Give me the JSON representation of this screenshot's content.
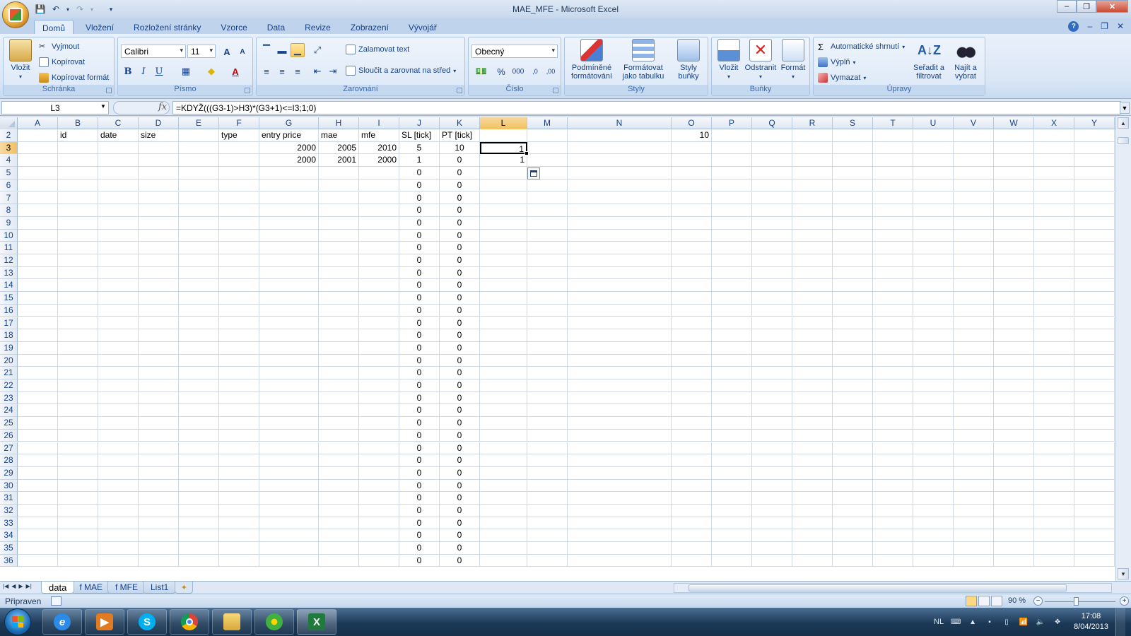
{
  "window": {
    "title": "MAE_MFE - Microsoft Excel",
    "minimize": "–",
    "restore": "❐",
    "close": "✕"
  },
  "ribbon_tabs": [
    "Domů",
    "Vložení",
    "Rozložení stránky",
    "Vzorce",
    "Data",
    "Revize",
    "Zobrazení",
    "Vývojář"
  ],
  "ribbon": {
    "clipboard": {
      "label": "Schránka",
      "paste": "Vložit",
      "cut": "Vyjmout",
      "copy": "Kopírovat",
      "format_painter": "Kopírovat formát"
    },
    "font": {
      "label": "Písmo",
      "font_name": "Calibri",
      "font_size": "11",
      "bold": "B",
      "italic": "I",
      "underline": "U",
      "grow": "A",
      "shrink": "A"
    },
    "alignment": {
      "label": "Zarovnání",
      "wrap": "Zalamovat text",
      "merge": "Sloučit a zarovnat na střed"
    },
    "number": {
      "label": "Číslo",
      "format": "Obecný",
      "percent": "%",
      "thousands": "000",
      "inc_decimal": ",0",
      "dec_decimal": ",00"
    },
    "styles": {
      "label": "Styly",
      "conditional": "Podmíněné formátování",
      "as_table": "Formátovat jako tabulku",
      "cell_styles": "Styly buňky"
    },
    "cells": {
      "label": "Buňky",
      "insert": "Vložit",
      "delete": "Odstranit",
      "format": "Formát"
    },
    "editing": {
      "label": "Úpravy",
      "autosum": "Automatické shrnutí",
      "fill": "Výplň",
      "clear": "Vymazat",
      "sort": "Seřadit a filtrovat",
      "find": "Najít a vybrat"
    }
  },
  "formula_bar": {
    "name_box": "L3",
    "fx": "fx",
    "formula": "=KDYŽ(((G3-1)>H3)*(G3+1)<=I3;1;0)"
  },
  "columns": [
    "A",
    "B",
    "C",
    "D",
    "E",
    "F",
    "G",
    "H",
    "I",
    "J",
    "K",
    "L",
    "M",
    "N",
    "O",
    "P",
    "Q",
    "R",
    "S",
    "T",
    "U",
    "V",
    "W",
    "X",
    "Y"
  ],
  "selected_column": "L",
  "selected_row": "3",
  "row_numbers": [
    "2",
    "3",
    "4",
    "5",
    "6",
    "7",
    "8",
    "9",
    "10",
    "11",
    "12",
    "13",
    "14",
    "15",
    "16",
    "17",
    "18",
    "19",
    "20",
    "21",
    "22",
    "23",
    "24",
    "25",
    "26",
    "27",
    "28",
    "29",
    "30",
    "31",
    "32",
    "33",
    "34",
    "35",
    "36"
  ],
  "header_row": {
    "B": "id",
    "C": "date",
    "D": "size",
    "F": "type",
    "G": "entry price",
    "H": "mae",
    "I": "mfe",
    "J": "SL [tick]",
    "K": "PT [tick]",
    "O": "10"
  },
  "data_rows": [
    {
      "G": "2000",
      "H": "2005",
      "I": "2010",
      "J": "5",
      "K": "10",
      "L": "1"
    },
    {
      "G": "2000",
      "H": "2001",
      "I": "2000",
      "J": "1",
      "K": "0",
      "L": "1"
    }
  ],
  "zero_value": "0",
  "sheet_tabs": [
    "data",
    "f MAE",
    "f MFE",
    "List1"
  ],
  "active_sheet": "data",
  "status": {
    "text": "Připraven",
    "zoom": "90 %",
    "zoom_percent": 90
  },
  "taskbar": {
    "apps": [
      "internet-explorer",
      "media-player",
      "skype",
      "chrome",
      "file-explorer",
      "icq",
      "excel"
    ],
    "lang": "NL",
    "time": "17:08",
    "date": "8/04/2013"
  }
}
